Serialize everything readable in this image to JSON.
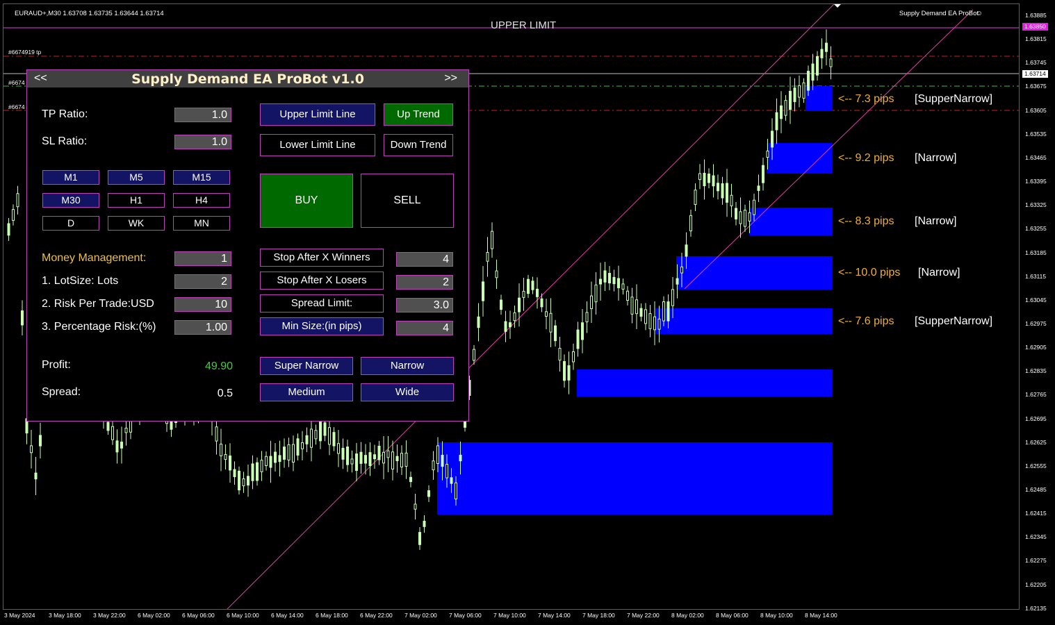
{
  "chart": {
    "header": "EURAUD+,M30  1.63708 1.63735 1.63644 1.63714",
    "ea_name": "Supply Demand EA ProBot",
    "upper_limit_label": "UPPER LIMIT",
    "order_labels": [
      "#6674919 tp",
      "#6674",
      "#6674"
    ],
    "price_ticks": [
      "1.63885",
      "1.63815",
      "1.63745",
      "1.63675",
      "1.63605",
      "1.63535",
      "1.63465",
      "1.63395",
      "1.63325",
      "1.63255",
      "1.63185",
      "1.63115",
      "1.63045",
      "1.62975",
      "1.62905",
      "1.62835",
      "1.62765",
      "1.62695",
      "1.62625",
      "1.62555",
      "1.62485",
      "1.62415",
      "1.62345",
      "1.62275",
      "1.62205",
      "1.62135"
    ],
    "price_badges": [
      {
        "text": "1.63850",
        "bg": "#e020e0",
        "color": "#ffffff"
      },
      {
        "text": "1.63714",
        "bg": "#ffffff",
        "color": "#000000"
      }
    ],
    "time_ticks": [
      "3 May 2024",
      "3 May 18:00",
      "3 May 22:00",
      "6 May 02:00",
      "6 May 06:00",
      "6 May 10:00",
      "6 May 14:00",
      "6 May 18:00",
      "6 May 22:00",
      "7 May 02:00",
      "7 May 06:00",
      "7 May 10:00",
      "7 May 14:00",
      "7 May 18:00",
      "7 May 22:00",
      "8 May 02:00",
      "8 May 06:00",
      "8 May 10:00",
      "8 May 14:00"
    ],
    "zones": [
      {
        "pips": "<-- 7.3 pips",
        "type": "[SupperNarrow]"
      },
      {
        "pips": "<-- 9.2 pips",
        "type": "[Narrow]"
      },
      {
        "pips": "<-- 8.3 pips",
        "type": "[Narrow]"
      },
      {
        "pips": "<-- 10.0 pips",
        "type": "[Narrow]"
      },
      {
        "pips": "<-- 7.6 pips",
        "type": "[SupperNarrow]"
      }
    ],
    "colors": {
      "candle": "#c8ffb0",
      "zone": "#0000ff",
      "channel": "#e040a0",
      "level_red": "#d02020",
      "level_green": "#40c040"
    }
  },
  "panel": {
    "title": "Supply Demand EA ProBot v1.0",
    "nav_prev": "<<",
    "nav_next": ">>",
    "tp_ratio_label": "TP Ratio:",
    "tp_ratio_value": "1.0",
    "sl_ratio_label": "SL Ratio:",
    "sl_ratio_value": "1.0",
    "upper_limit_line": "Upper Limit Line",
    "lower_limit_line": "Lower Limit Line",
    "up_trend": "Up Trend",
    "down_trend": "Down Trend",
    "timeframes": [
      "M1",
      "M5",
      "M15",
      "M30",
      "H1",
      "H4",
      "D",
      "WK",
      "MN"
    ],
    "buy": "BUY",
    "sell": "SELL",
    "money_management_label": "Money Management:",
    "money_management_value": "1",
    "lotsize_label": "1. LotSize: Lots",
    "lotsize_value": "2",
    "risk_label": "2. Risk Per Trade:USD",
    "risk_value": "10",
    "percentage_label": "3. Percentage Risk:(%)",
    "percentage_value": "1.00",
    "stop_winners": "Stop After X Winners",
    "stop_winners_value": "4",
    "stop_losers": "Stop After X Losers",
    "stop_losers_value": "2",
    "spread_limit": "Spread Limit:",
    "spread_limit_value": "3.0",
    "min_size": "Min Size:(in pips)",
    "min_size_value": "4",
    "profit_label": "Profit:",
    "profit_value": "49.90",
    "spread_label": "Spread:",
    "spread_value": "0.5",
    "super_narrow": "Super Narrow",
    "narrow": "Narrow",
    "medium": "Medium",
    "wide": "Wide",
    "colors": {
      "profit": "#40d040",
      "gold": "#f0c040"
    }
  }
}
